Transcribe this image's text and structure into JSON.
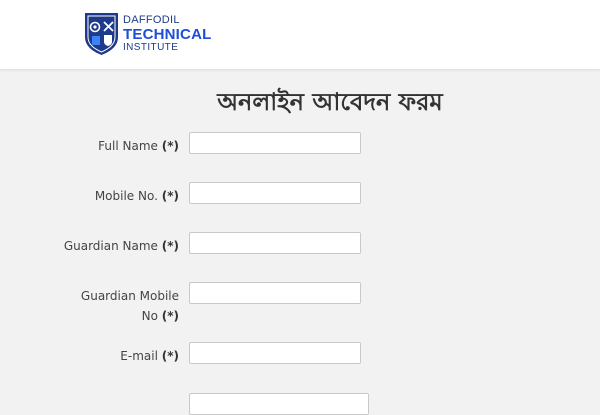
{
  "brand": {
    "line1": "DAFFODIL",
    "line2": "TECHNICAL",
    "line3": "INSTITUTE",
    "primary_color": "#1e3a8a",
    "accent_color": "#1d4ed8"
  },
  "page": {
    "title": "অনলাইন আবেদন ফরম"
  },
  "form": {
    "required_marker": "(*)",
    "fields": [
      {
        "label": "Full Name",
        "value": "",
        "placeholder": ""
      },
      {
        "label": "Mobile No.",
        "value": "",
        "placeholder": ""
      },
      {
        "label": "Guardian Name",
        "value": "",
        "placeholder": ""
      },
      {
        "label_line1": "Guardian Mobile",
        "label_line2": "No",
        "value": "",
        "placeholder": ""
      },
      {
        "label": "E-mail",
        "value": "",
        "placeholder": ""
      }
    ]
  }
}
